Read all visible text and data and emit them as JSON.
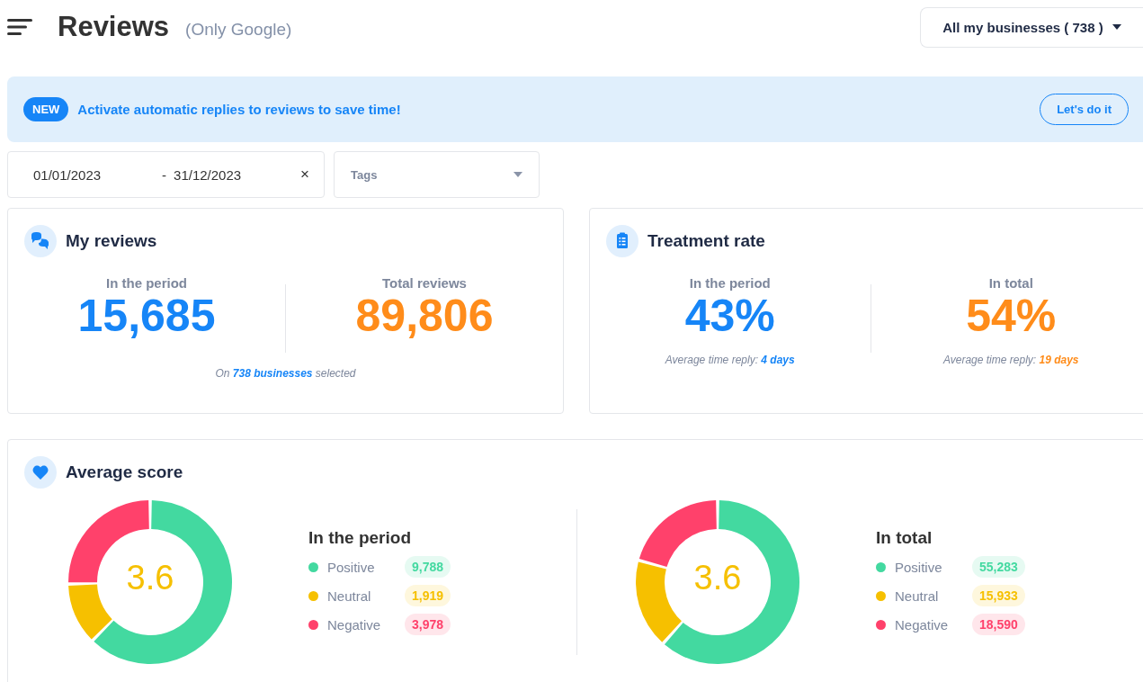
{
  "header": {
    "title": "Reviews",
    "subtitle": "(Only Google)",
    "business_selector": "All my businesses ( 738 )"
  },
  "banner": {
    "badge": "NEW",
    "message": "Activate automatic replies to reviews to save time!",
    "button": "Let's do it"
  },
  "filters": {
    "date_start": "01/01/2023",
    "date_separator": "-",
    "date_end": "31/12/2023",
    "clear": "×",
    "tags_placeholder": "Tags"
  },
  "my_reviews": {
    "title": "My reviews",
    "stats": [
      {
        "label": "In the period",
        "value": "15,685"
      },
      {
        "label": "Total reviews",
        "value": "89,806"
      }
    ],
    "footer": "On **738 businesses** selected"
  },
  "treatment_rate": {
    "title": "Treatment rate",
    "stats": [
      {
        "label": "In the period",
        "value": "43%",
        "note": "Average time reply: **4 days**"
      },
      {
        "label": "In total",
        "value": "54%",
        "note": "Average time reply: **19 days**"
      }
    ]
  },
  "average_score": {
    "title": "Average score",
    "panels": [
      {
        "score": "3.6",
        "title": "In the period",
        "legend": [
          {
            "count": "9,788",
            "color": "#43d9a0"
          },
          {
            "count": "1,919",
            "color": "#f6c000"
          },
          {
            "count": "3,978",
            "color": "#ff416b"
          }
        ],
        "chart_data": {
          "type": "donut",
          "categories": [
            "Positive",
            "Neutral",
            "Negative"
          ],
          "values": [
            62.4,
            12.23,
            25.37
          ]
        }
      },
      {
        "score": "3.6",
        "title": "In total",
        "legend": [
          {
            "count": "55,283",
            "color": "#43d9a0"
          },
          {
            "count": "15,933",
            "color": "#f6c000"
          },
          {
            "count": "18,590",
            "color": "#ff416b"
          }
        ],
        "chart_data": {
          "type": "donut",
          "categories": [
            "Positive",
            "Neutral",
            "Negative"
          ],
          "values": [
            61.56,
            17.74,
            20.7
          ]
        }
      }
    ]
  }
}
